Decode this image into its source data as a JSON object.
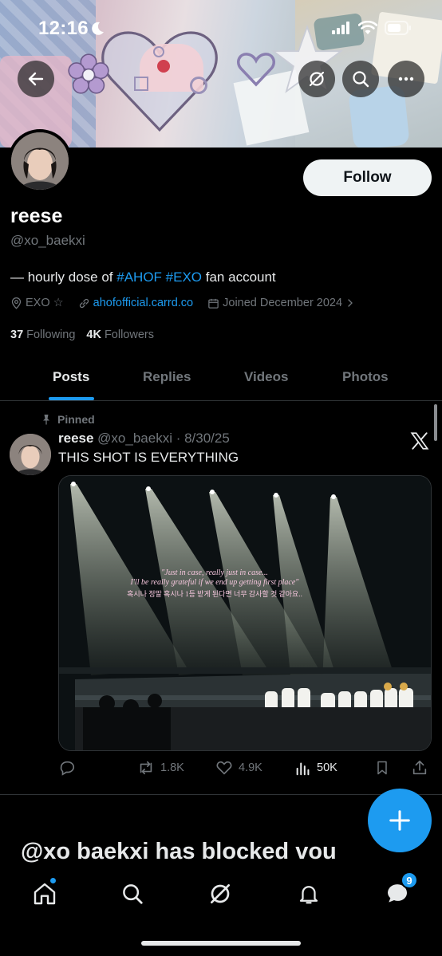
{
  "status_bar": {
    "time": "12:16"
  },
  "profile": {
    "display_name": "reese",
    "handle": "@xo_baekxi",
    "bio_prefix": "— hourly dose of ",
    "bio_tag1": "#AHOF",
    "bio_tag2": "#EXO",
    "bio_suffix": " fan account",
    "location": "EXO ☆",
    "link": "ahofofficial.carrd.co",
    "joined": "Joined December 2024",
    "following_count": "37",
    "following_label": "Following",
    "followers_count": "4K",
    "followers_label": "Followers",
    "follow_label": "Follow"
  },
  "tabs": [
    {
      "label": "Posts",
      "active": true
    },
    {
      "label": "Replies",
      "active": false
    },
    {
      "label": "Videos",
      "active": false
    },
    {
      "label": "Photos",
      "active": false
    }
  ],
  "post": {
    "pinned_label": "Pinned",
    "author_name": "reese",
    "author_handle": "@xo_baekxi · 8/30/25",
    "text": "THIS SHOT IS EVERYTHING",
    "image_caption_line1": "\"Just in case, really just in case...",
    "image_caption_line2": "I'll be really grateful if we end up getting first place\"",
    "image_caption_line3": "혹시나 정말 혹시나 1등 받게 된다면 너무 감사할 것 같아요..",
    "reposts": "1.8K",
    "likes": "4.9K",
    "views": "50K"
  },
  "blocked_notice": "@xo baekxi has blocked vou",
  "bottom_nav": {
    "messages_badge": "9"
  },
  "colors": {
    "accent": "#1d9bf0",
    "background": "#000000",
    "text_primary": "#e7e9ea",
    "text_secondary": "#71767b"
  }
}
